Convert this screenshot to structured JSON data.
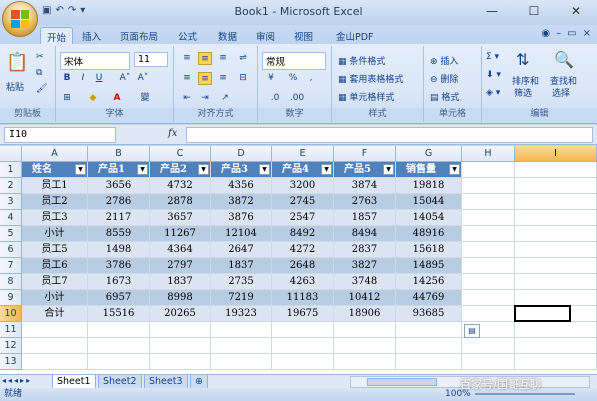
{
  "window": {
    "title": "Book1 - Microsoft Excel"
  },
  "qat": [
    "save-icon",
    "undo-icon",
    "redo-icon",
    "customize-icon"
  ],
  "tabs": [
    "开始",
    "插入",
    "页面布局",
    "公式",
    "数据",
    "审阅",
    "视图",
    "金山PDF"
  ],
  "ribbon": {
    "clipboard": {
      "paste": "粘贴",
      "label": "剪贴板"
    },
    "font": {
      "name": "宋体",
      "size": "11",
      "label": "字体"
    },
    "alignment": {
      "label": "对齐方式"
    },
    "number": {
      "format": "常规",
      "percent": "%",
      "comma": ",",
      "label": "数字"
    },
    "styles": {
      "cond": "条件格式",
      "table": "套用表格格式",
      "cell": "单元格样式",
      "label": "样式"
    },
    "cells": {
      "insert": "插入",
      "delete": "删除",
      "format": "格式",
      "label": "单元格"
    },
    "editing": {
      "sort": "排序和",
      "sort2": "筛选",
      "find": "查找和",
      "find2": "选择",
      "label": "编辑"
    }
  },
  "formula_bar": {
    "name_box": "I10",
    "fx": "fx"
  },
  "columns": [
    "A",
    "B",
    "C",
    "D",
    "E",
    "F",
    "G",
    "H",
    "I"
  ],
  "rows": [
    "1",
    "2",
    "3",
    "4",
    "5",
    "6",
    "7",
    "8",
    "9",
    "10",
    "11",
    "12",
    "13"
  ],
  "table": {
    "headers": [
      "姓名",
      "产品1",
      "产品2",
      "产品3",
      "产品4",
      "产品5",
      "销售量"
    ],
    "data": [
      [
        "员工1",
        "3656",
        "4732",
        "4356",
        "3200",
        "3874",
        "19818"
      ],
      [
        "员工2",
        "2786",
        "2878",
        "3872",
        "2745",
        "2763",
        "15044"
      ],
      [
        "员工3",
        "2117",
        "3657",
        "3876",
        "2547",
        "1857",
        "14054"
      ],
      [
        "小计",
        "8559",
        "11267",
        "12104",
        "8492",
        "8494",
        "48916"
      ],
      [
        "员工5",
        "1498",
        "4364",
        "2647",
        "4272",
        "2837",
        "15618"
      ],
      [
        "员工6",
        "3786",
        "2797",
        "1837",
        "2648",
        "3827",
        "14895"
      ],
      [
        "员工7",
        "1673",
        "1837",
        "2735",
        "4263",
        "3748",
        "14256"
      ],
      [
        "小计",
        "6957",
        "8998",
        "7219",
        "11183",
        "10412",
        "44769"
      ],
      [
        "合计",
        "15516",
        "20265",
        "19323",
        "19675",
        "18906",
        "93685"
      ]
    ]
  },
  "sheets": [
    "Sheet1",
    "Sheet2",
    "Sheet3"
  ],
  "status": {
    "ready": "就绪",
    "zoom": "100%"
  },
  "watermark": "百家号/国哥互聊"
}
